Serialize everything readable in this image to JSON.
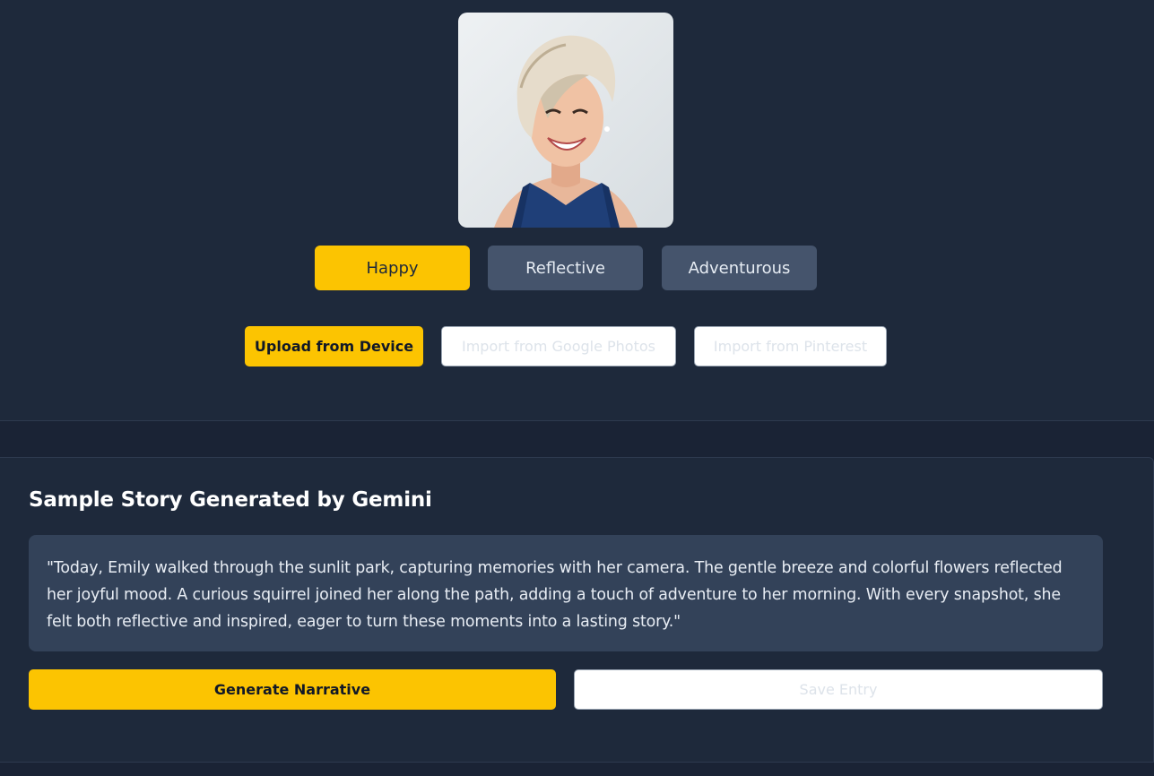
{
  "profile": {
    "photo_alt": "portrait"
  },
  "moods": [
    {
      "label": "Happy",
      "active": true
    },
    {
      "label": "Reflective",
      "active": false
    },
    {
      "label": "Adventurous",
      "active": false
    }
  ],
  "sources": {
    "upload": "Upload from Device",
    "google_photos": "Import from Google Photos",
    "pinterest": "Import from Pinterest"
  },
  "story": {
    "title": "Sample Story Generated by Gemini",
    "text": "\"Today, Emily walked through the sunlit park, capturing memories with her camera. The gentle breeze and colorful flowers reflected her joyful mood. A curious squirrel joined her along the path, adding a touch of adventure to her morning. With every snapshot, she felt both reflective and inspired, eager to turn these moments into a lasting story.\""
  },
  "actions": {
    "generate": "Generate Narrative",
    "save": "Save Entry"
  },
  "colors": {
    "background": "#1e293b",
    "accent": "#fcc401",
    "inactive_button": "#45546c",
    "story_box": "#334259"
  }
}
